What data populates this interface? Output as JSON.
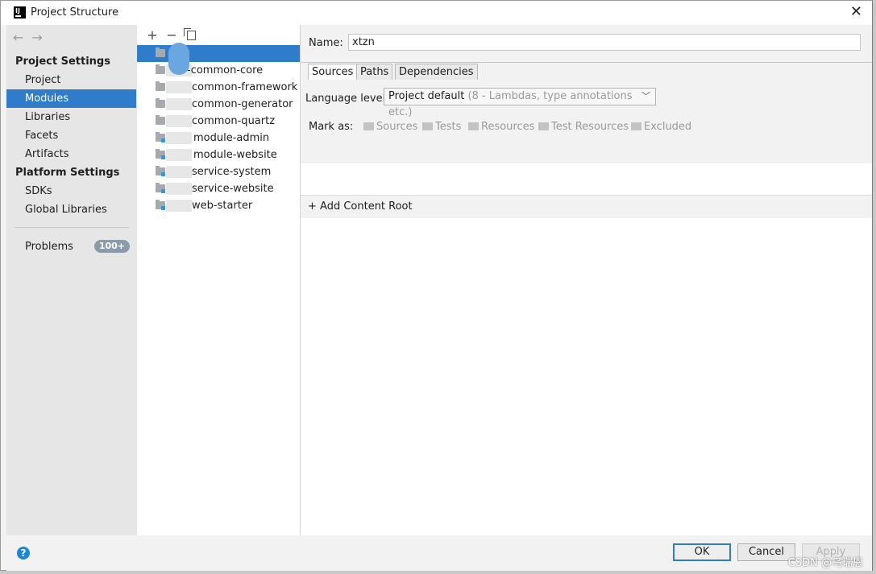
{
  "window": {
    "title": "Project Structure"
  },
  "sidebar": {
    "project_settings_header": "Project Settings",
    "platform_settings_header": "Platform Settings",
    "items": [
      {
        "label": "Project"
      },
      {
        "label": "Modules"
      },
      {
        "label": "Libraries"
      },
      {
        "label": "Facets"
      },
      {
        "label": "Artifacts"
      },
      {
        "label": "SDKs"
      },
      {
        "label": "Global Libraries"
      },
      {
        "label": "Problems"
      }
    ],
    "problems_badge": "100+"
  },
  "modules": {
    "toolbar": {
      "add": "+",
      "remove": "−"
    },
    "items": [
      {
        "label": ""
      },
      {
        "label": "-common-core"
      },
      {
        "label": "common-framework"
      },
      {
        "label": "common-generator"
      },
      {
        "label": "common-quartz"
      },
      {
        "label": "module-admin"
      },
      {
        "label": "module-website"
      },
      {
        "label": "service-system"
      },
      {
        "label": "service-website"
      },
      {
        "label": "web-starter"
      }
    ]
  },
  "content": {
    "name_label": "Name:",
    "name_value": "xtzn",
    "tabs": [
      {
        "label": "Sources"
      },
      {
        "label": "Paths"
      },
      {
        "label": "Dependencies"
      }
    ],
    "language_level_label": "Language level:",
    "language_level_value": "Project default",
    "language_level_hint": "(8 - Lambdas, type annotations etc.)",
    "mark_as_label": "Mark as:",
    "mark_as_buttons": [
      {
        "label": "Sources"
      },
      {
        "label": "Tests"
      },
      {
        "label": "Resources"
      },
      {
        "label": "Test Resources"
      },
      {
        "label": "Excluded"
      }
    ],
    "add_content_root": "+ Add Content Root"
  },
  "buttons": {
    "ok": "OK",
    "cancel": "Cancel",
    "apply": "Apply",
    "help": "?"
  },
  "watermark": "CSDN @乌瑞恩"
}
